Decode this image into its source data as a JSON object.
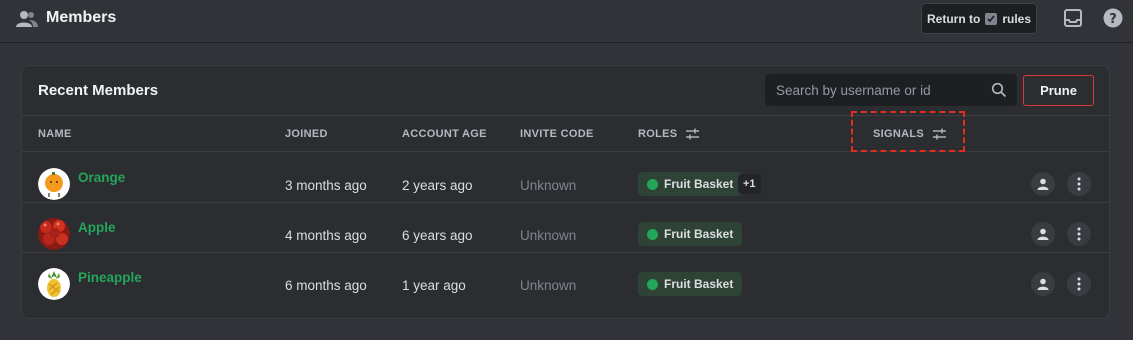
{
  "header": {
    "title": "Members",
    "return_prefix": "Return to",
    "return_suffix": "rules"
  },
  "card": {
    "title": "Recent Members",
    "search_placeholder": "Search by username or id",
    "prune_label": "Prune"
  },
  "columns": {
    "name": "NAME",
    "joined": "JOINED",
    "account_age": "ACCOUNT AGE",
    "invite_code": "INVITE CODE",
    "roles": "ROLES",
    "signals": "SIGNALS"
  },
  "rows": [
    {
      "username": "Orange",
      "joined": "3 months ago",
      "account_age": "2 years ago",
      "invite_code": "Unknown",
      "role": "Fruit Basket",
      "extra_roles": "+1"
    },
    {
      "username": "Apple",
      "joined": "4 months ago",
      "account_age": "6 years ago",
      "invite_code": "Unknown",
      "role": "Fruit Basket"
    },
    {
      "username": "Pineapple",
      "joined": "6 months ago",
      "account_age": "1 year ago",
      "invite_code": "Unknown",
      "role": "Fruit Basket"
    }
  ],
  "colors": {
    "background": "#313338",
    "card": "#2b2d31",
    "username": "#23a55a",
    "role_dot": "#23a55a",
    "prune_border": "#da373c",
    "highlight": "#e02d1f"
  },
  "icons": {
    "header": "members-icon",
    "inbox": "inbox-icon",
    "help": "help-icon",
    "search": "search-icon",
    "filter": "filter-icon",
    "profile": "user-icon",
    "more": "more-vertical-icon"
  }
}
